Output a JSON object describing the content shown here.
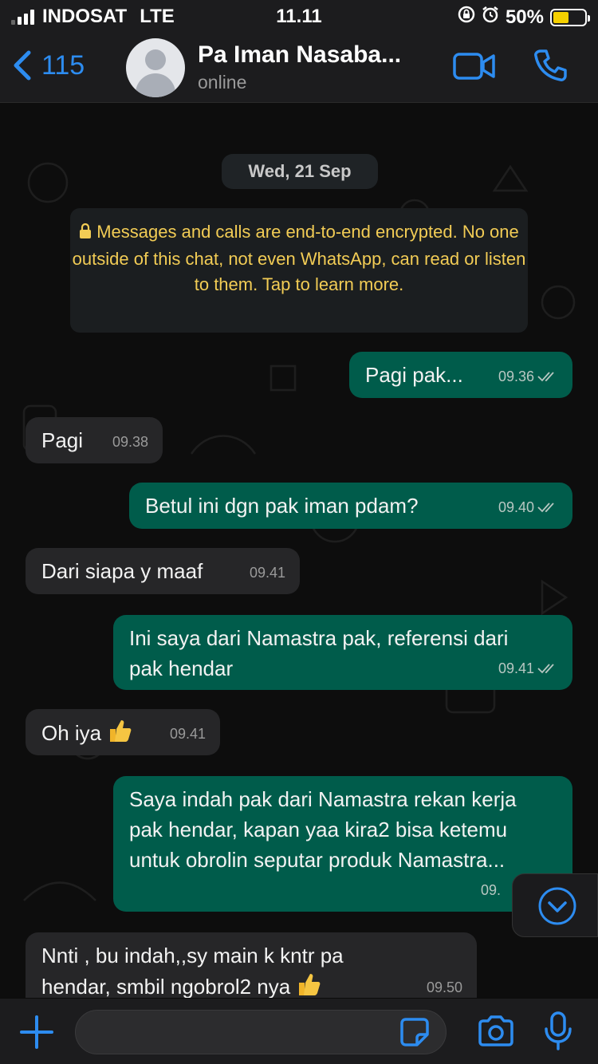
{
  "status_bar": {
    "carrier": "INDOSAT",
    "network": "LTE",
    "time": "11.11",
    "battery_percent": "50%",
    "battery_level": 0.5
  },
  "header": {
    "back_count": "115",
    "contact_name": "Pa Iman Nasaba...",
    "contact_status": "online",
    "icons": [
      "back-chevron-icon",
      "video-call-icon",
      "phone-icon"
    ]
  },
  "chat": {
    "date_label": "Wed, 21 Sep",
    "encryption_notice": "Messages and calls are end-to-end encrypted. No one outside of this chat, not even WhatsApp, can read or listen to them. Tap to learn more.",
    "messages": [
      {
        "dir": "out",
        "text": "Pagi pak...",
        "time": "09.36"
      },
      {
        "dir": "in",
        "text": "Pagi",
        "time": "09.38"
      },
      {
        "dir": "out",
        "text": "Betul ini dgn pak iman pdam?",
        "time": "09.40"
      },
      {
        "dir": "in",
        "text": "Dari siapa y maaf",
        "time": "09.41"
      },
      {
        "dir": "out",
        "text": "Ini saya dari Namastra pak, referensi dari pak hendar",
        "time": "09.41"
      },
      {
        "dir": "in",
        "text": "Oh iya",
        "emoji": "thumbs-up",
        "time": "09.41"
      },
      {
        "dir": "out",
        "text": "Saya indah pak dari Namastra rekan kerja pak hendar, kapan yaa kira2 bisa ketemu untuk obrolin seputar produk Namastra...",
        "time": "09."
      },
      {
        "dir": "in",
        "text": "Nnti , bu indah,,sy main k kntr pa hendar, smbil ngobrol2 nya",
        "emoji": "thumbs-up",
        "time": "09.50"
      }
    ]
  },
  "input_bar": {
    "message_value": "",
    "icons": [
      "plus-icon",
      "sticker-icon",
      "camera-icon",
      "microphone-icon"
    ]
  },
  "colors": {
    "accent": "#2d8cf0",
    "outgoing_bubble": "#005c4b",
    "incoming_bubble": "#262628",
    "notice_text": "#f2cc55"
  }
}
